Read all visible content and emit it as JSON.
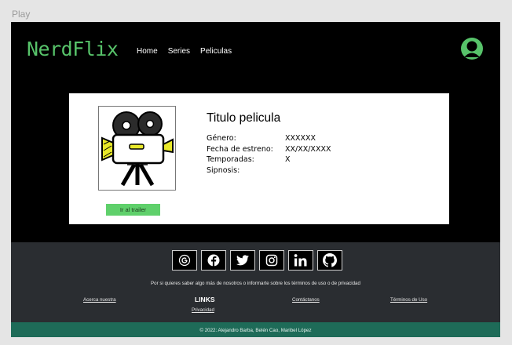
{
  "frame": {
    "label": "Play"
  },
  "header": {
    "logo": "NerdFlix",
    "nav": [
      "Home",
      "Series",
      "Peliculas"
    ]
  },
  "movie": {
    "title": "Titulo pelicula",
    "fields": [
      {
        "label": "Género:",
        "value": "XXXXXX"
      },
      {
        "label": "Fecha de estreno:",
        "value": "XX/XX/XXXX"
      },
      {
        "label": "Temporadas:",
        "value": "X"
      },
      {
        "label": "Sipnosis:",
        "value": ""
      }
    ],
    "trailer_button": "Ir al trailer"
  },
  "footer": {
    "socials": [
      "google-icon",
      "facebook-icon",
      "twitter-icon",
      "instagram-icon",
      "linkedin-icon",
      "github-icon"
    ],
    "text": "Por si quieres saber algo más de nosotros o informarte sobre los términos de uso o de privacidad",
    "links_title": "LINKS",
    "links": {
      "about": "Acerca nuestra",
      "contact": "Contáctanos",
      "terms": "Términos de Uso",
      "privacy": "Privacidad"
    },
    "copyright": "© 2022: Alejandro Barba, Belén Cao, Maribel López"
  },
  "colors": {
    "brand": "#57c36a",
    "button": "#5fd06b",
    "footer": "#2a2d31",
    "bottom_bar": "#1e6b58"
  }
}
